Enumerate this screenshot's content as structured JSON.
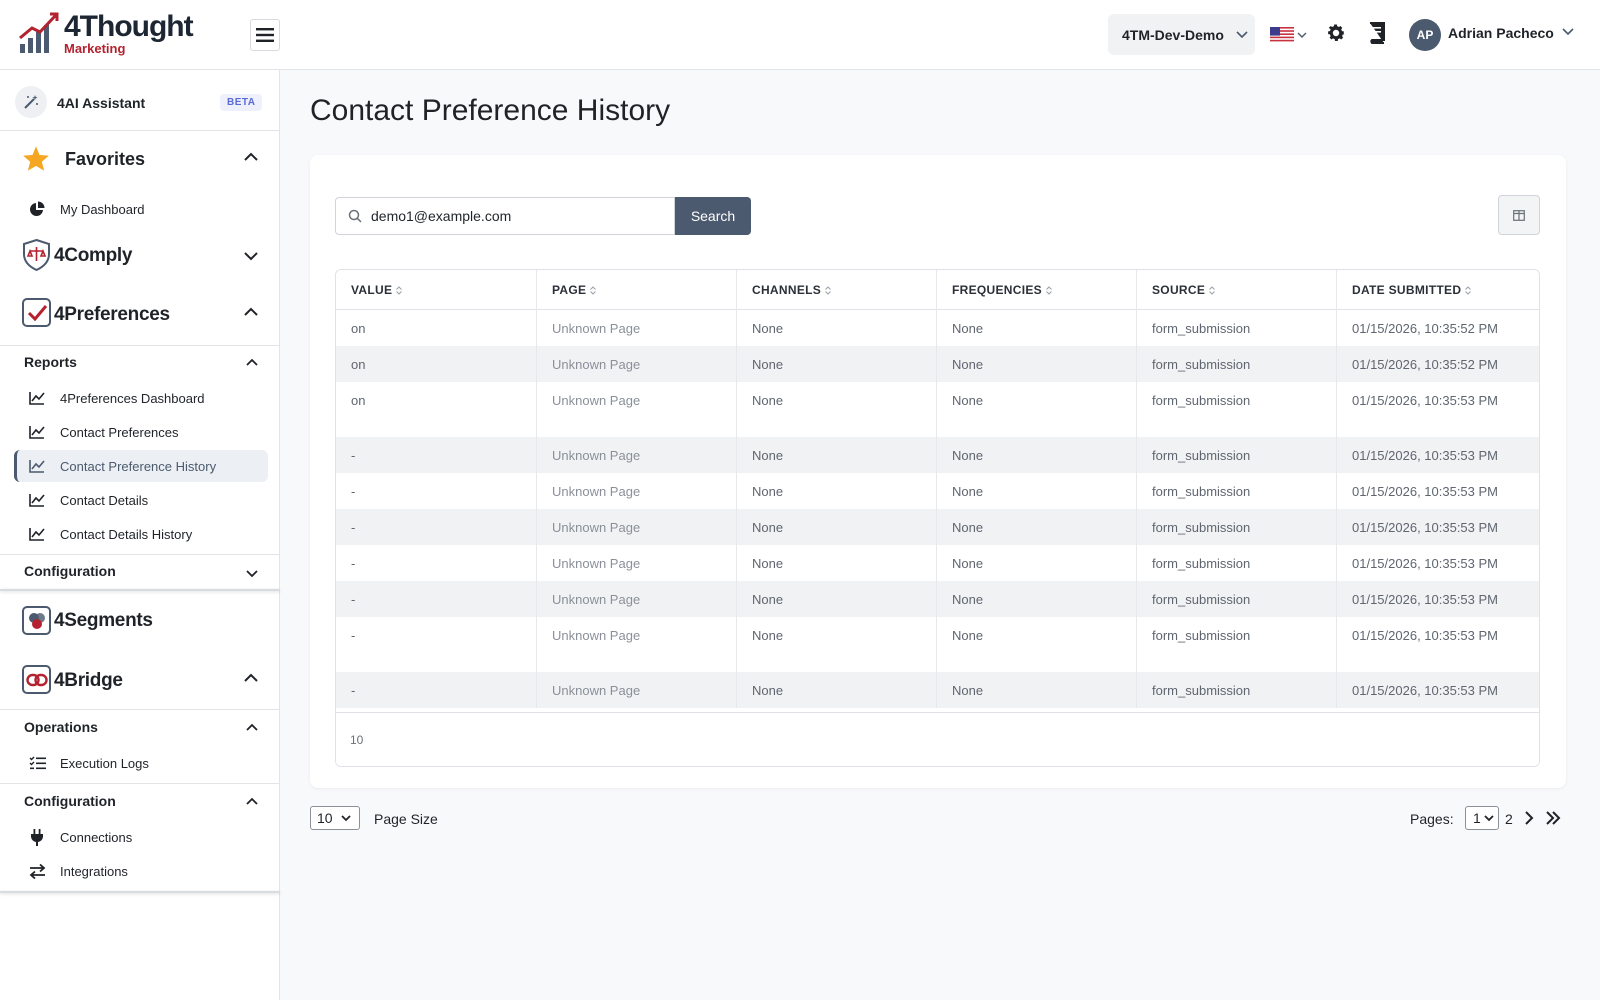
{
  "brand": {
    "name": "4Thought",
    "sub": "Marketing",
    "accent": "#b3222e"
  },
  "header": {
    "org": "4TM-Dev-Demo",
    "user_initials": "AP",
    "user_name": "Adrian Pacheco"
  },
  "sidebar": {
    "ai_assistant": {
      "label": "4AI Assistant",
      "badge": "BETA"
    },
    "favorites": {
      "title": "Favorites",
      "items": [
        {
          "label": "My Dashboard"
        }
      ]
    },
    "comply": {
      "title": "4Comply"
    },
    "preferences": {
      "title": "4Preferences",
      "reports_title": "Reports",
      "reports": [
        {
          "label": "4Preferences Dashboard"
        },
        {
          "label": "Contact Preferences"
        },
        {
          "label": "Contact Preference History"
        },
        {
          "label": "Contact Details"
        },
        {
          "label": "Contact Details History"
        }
      ],
      "config_title": "Configuration"
    },
    "segments": {
      "title": "4Segments"
    },
    "bridge": {
      "title": "4Bridge",
      "operations_title": "Operations",
      "operations": [
        {
          "label": "Execution Logs"
        }
      ],
      "config_title": "Configuration",
      "config": [
        {
          "label": "Connections"
        },
        {
          "label": "Integrations"
        }
      ]
    }
  },
  "main": {
    "title": "Contact Preference History",
    "search": {
      "value": "demo1@example.com",
      "button": "Search"
    },
    "table": {
      "columns": [
        "VALUE",
        "PAGE",
        "CHANNELS",
        "FREQUENCIES",
        "SOURCE",
        "DATE SUBMITTED"
      ],
      "rows": [
        [
          "on",
          "Unknown Page",
          "None",
          "None",
          "form_submission",
          "01/15/2026, 10:35:52 PM"
        ],
        [
          "on",
          "Unknown Page",
          "None",
          "None",
          "form_submission",
          "01/15/2026, 10:35:52 PM"
        ],
        [
          "on",
          "Unknown Page",
          "None",
          "None",
          "form_submission",
          "01/15/2026, 10:35:53 PM"
        ],
        [
          "-",
          "Unknown Page",
          "None",
          "None",
          "form_submission",
          "01/15/2026, 10:35:53 PM"
        ],
        [
          "-",
          "Unknown Page",
          "None",
          "None",
          "form_submission",
          "01/15/2026, 10:35:53 PM"
        ],
        [
          "-",
          "Unknown Page",
          "None",
          "None",
          "form_submission",
          "01/15/2026, 10:35:53 PM"
        ],
        [
          "-",
          "Unknown Page",
          "None",
          "None",
          "form_submission",
          "01/15/2026, 10:35:53 PM"
        ],
        [
          "-",
          "Unknown Page",
          "None",
          "None",
          "form_submission",
          "01/15/2026, 10:35:53 PM"
        ],
        [
          "-",
          "Unknown Page",
          "None",
          "None",
          "form_submission",
          "01/15/2026, 10:35:53 PM"
        ],
        [
          "-",
          "Unknown Page",
          "None",
          "None",
          "form_submission",
          "01/15/2026, 10:35:53 PM"
        ]
      ],
      "footer_count": "10"
    }
  },
  "pager": {
    "page_size": "10",
    "page_size_label": "Page Size",
    "pages_label": "Pages:",
    "current_page": "1",
    "next_page": "2"
  }
}
